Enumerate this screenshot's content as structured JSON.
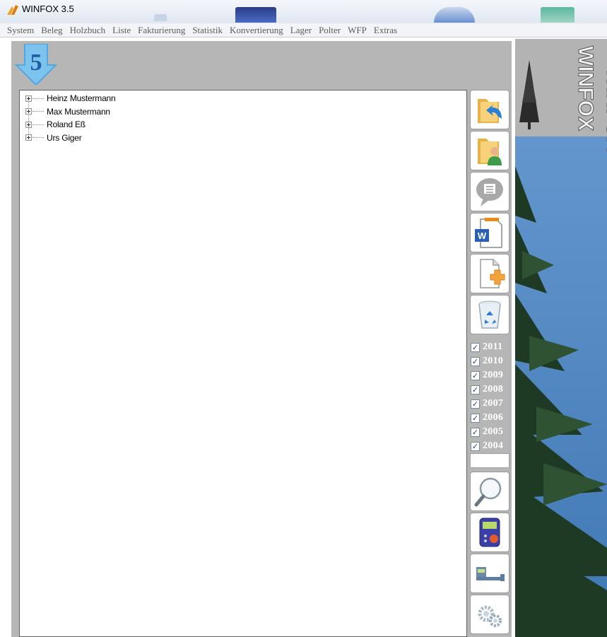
{
  "window": {
    "title": "WINFOX 3.5"
  },
  "menu": [
    "System",
    "Beleg",
    "Holzbuch",
    "Liste",
    "Fakturierung",
    "Statistik",
    "Konvertierung",
    "Lager",
    "Polter",
    "WFP",
    "Extras"
  ],
  "badge": {
    "number": "5"
  },
  "tree": {
    "items": [
      "Heinz Mustermann",
      "Max Mustermann",
      "Roland Eß",
      "Urs Giger"
    ]
  },
  "toolbar": {
    "top_buttons": [
      "folder-shortcut-icon",
      "folder-user-icon",
      "speech-bubble-icon",
      "word-document-icon",
      "new-document-icon",
      "recycle-bin-icon"
    ],
    "bottom_buttons": [
      "magnifier-icon",
      "handheld-device-icon",
      "caliper-icon",
      "gears-icon"
    ]
  },
  "years": [
    {
      "label": "2011",
      "checked": true
    },
    {
      "label": "2010",
      "checked": true
    },
    {
      "label": "2009",
      "checked": true
    },
    {
      "label": "2008",
      "checked": true
    },
    {
      "label": "2007",
      "checked": true
    },
    {
      "label": "2006",
      "checked": true
    },
    {
      "label": "2005",
      "checked": true
    },
    {
      "label": "2004",
      "checked": true
    }
  ],
  "logo": {
    "text": "WINFOX"
  },
  "colors": {
    "panel": "#b6b6b6",
    "accent": "#4fa8e0",
    "sky": "#4f87bd",
    "tree": "#1f3a24"
  }
}
